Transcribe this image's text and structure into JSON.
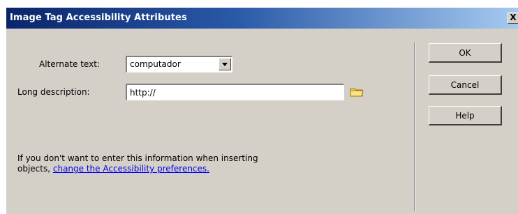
{
  "window": {
    "title": "Image Tag Accessibility Attributes",
    "close_label": "X"
  },
  "form": {
    "alt_label": "Alternate text:",
    "alt_value": "computador",
    "long_desc_label": "Long description:",
    "long_desc_value": "http://",
    "browse_icon": "folder-icon"
  },
  "info": {
    "text_line1": "If you don't want to enter this information when inserting",
    "text_line2_prefix": "objects, ",
    "link_text": "change the Accessibility preferences."
  },
  "buttons": {
    "ok": "OK",
    "cancel": "Cancel",
    "help": "Help"
  },
  "colors": {
    "dialog_bg": "#d4d0c8",
    "title_start": "#0a246a",
    "title_end": "#a6caf0",
    "link": "#0000ee"
  }
}
